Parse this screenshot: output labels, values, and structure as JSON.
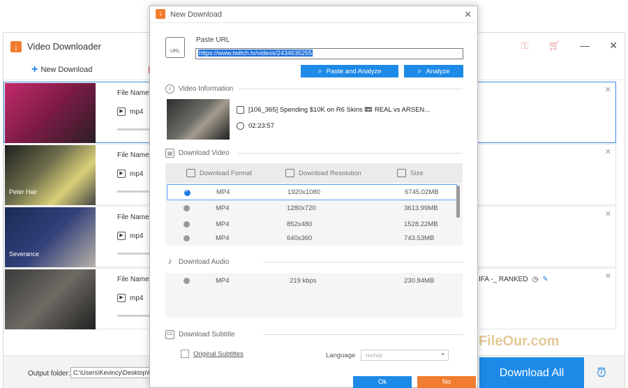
{
  "main": {
    "title": "Video Downloader",
    "new_download": "New Download",
    "items": [
      {
        "file_label": "File Name:",
        "format": "mp4",
        "caption": ""
      },
      {
        "file_label": "File Name:",
        "format": "mp4",
        "caption": "Peter Hair"
      },
      {
        "file_label": "File Name:",
        "format": "mp4",
        "caption": "Severance"
      },
      {
        "file_label": "File Name:",
        "format": "mp4",
        "caption": "",
        "right_text": "IFA -_ RANKED"
      }
    ],
    "output_label": "Output folder:",
    "output_path": "C:\\Users\\Kevincy\\Desktop\\Ou",
    "download_all": "Download All",
    "watermark": "FileOur.com"
  },
  "dialog": {
    "title": "New Download",
    "paste_url_label": "Paste URL",
    "url_value": "https://www.twitch.tv/videos/2434635255",
    "url_icon_text": "URL",
    "paste_analyze": "Paste and Analyze",
    "analyze": "Analyze",
    "video_info": {
      "heading": "Video Information",
      "title": "[106_365] Spending $10K on R6 Skins 📼 REAL vs ARSEN...",
      "duration": "02:23:57"
    },
    "download_video": {
      "heading": "Download Video",
      "headers": [
        "Download Format",
        "Download Resolution",
        "Size"
      ],
      "rows": [
        {
          "format": "MP4",
          "resolution": "1920x1080",
          "size": "6745.02MB",
          "selected": true
        },
        {
          "format": "MP4",
          "resolution": "1280x720",
          "size": "3613.99MB",
          "selected": false
        },
        {
          "format": "MP4",
          "resolution": "852x480",
          "size": "1528.22MB",
          "selected": false
        },
        {
          "format": "MP4",
          "resolution": "640x360",
          "size": "743.53MB",
          "selected": false
        }
      ]
    },
    "download_audio": {
      "heading": "Download Audio",
      "rows": [
        {
          "format": "MP4",
          "bitrate": "219 kbps",
          "size": "230.84MB"
        }
      ]
    },
    "download_subtitle": {
      "heading": "Download Subtitle",
      "original_subtitles": "Original Subtitles",
      "language_label": "Language",
      "language_value": "rechat"
    },
    "ok": "Ok",
    "no": "No"
  }
}
